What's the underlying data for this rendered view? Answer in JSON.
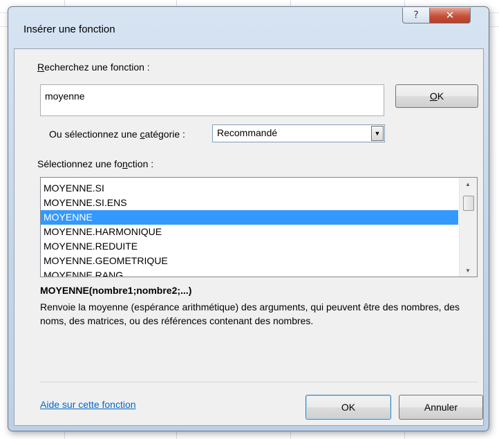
{
  "window": {
    "title": "Insérer une fonction",
    "help_glyph": "?",
    "close_glyph": "✕"
  },
  "search": {
    "label_accel": "R",
    "label_rest": "echerchez une fonction :",
    "value": "moyenne",
    "ok_accel": "O",
    "ok_rest": "K"
  },
  "category": {
    "label_pre": "Ou sélectionnez une ",
    "label_accel": "c",
    "label_post": "atégorie :",
    "selected": "Recommandé",
    "arrow_glyph": "▼"
  },
  "functions": {
    "label_pre": "Sélectionnez une fo",
    "label_accel": "n",
    "label_post": "ction :",
    "items": [
      "MOYENNE.SI",
      "MOYENNE.SI.ENS",
      "MOYENNE",
      "MOYENNE.HARMONIQUE",
      "MOYENNE.REDUITE",
      "MOYENNE.GEOMETRIQUE",
      "MOYENNE.RANG"
    ],
    "selected_index": 2,
    "scroll_up_glyph": "▲",
    "scroll_down_glyph": "▼"
  },
  "details": {
    "signature": "MOYENNE(nombre1;nombre2;...)",
    "description": "Renvoie la moyenne (espérance arithmétique) des arguments, qui peuvent être des nombres, des noms, des matrices, ou des références contenant des nombres."
  },
  "footer": {
    "help_link": "Aide sur cette fonction",
    "ok_label": "OK",
    "cancel_label": "Annuler"
  }
}
